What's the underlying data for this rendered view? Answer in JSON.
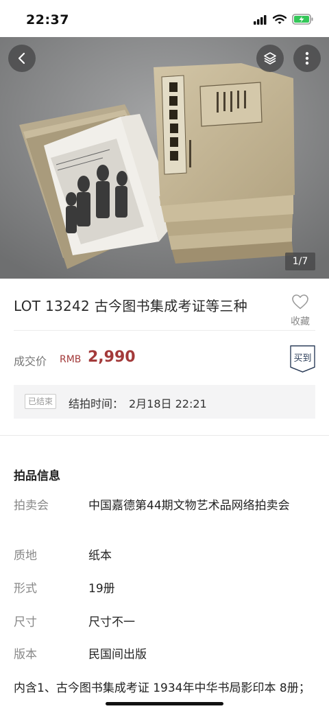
{
  "status_bar": {
    "time": "22:37",
    "icons": [
      "cellular-signal-icon",
      "wifi-icon",
      "battery-charging-icon"
    ]
  },
  "hero": {
    "page_counter": "1/7",
    "back_icon": "chevron-left-icon",
    "layers_icon": "layers-icon",
    "more_icon": "more-vertical-icon"
  },
  "lot": {
    "title": "LOT 13242 古今图书集成考证等三种",
    "favorite_label": "收藏",
    "favorite_icon": "heart-outline-icon"
  },
  "price": {
    "label": "成交价",
    "currency": "RMB",
    "value": "2,990",
    "bought_badge": "买到",
    "accent_color": "#a33a3a"
  },
  "auction_end": {
    "status_tag": "已结束",
    "time_label": "结拍时间：",
    "time_value": "2月18日 22:21"
  },
  "info": {
    "heading": "拍品信息",
    "rows": [
      {
        "key": "拍卖会",
        "value": "中国嘉德第44期文物艺术品网络拍卖会"
      },
      {
        "key": "质地",
        "value": "纸本"
      },
      {
        "key": "形式",
        "value": "19册"
      },
      {
        "key": "尺寸",
        "value": "尺寸不一"
      },
      {
        "key": "版本",
        "value": "民国间出版"
      }
    ],
    "description": "内含1、古今图书集成考证 1934年中华书局影印本 8册；"
  }
}
